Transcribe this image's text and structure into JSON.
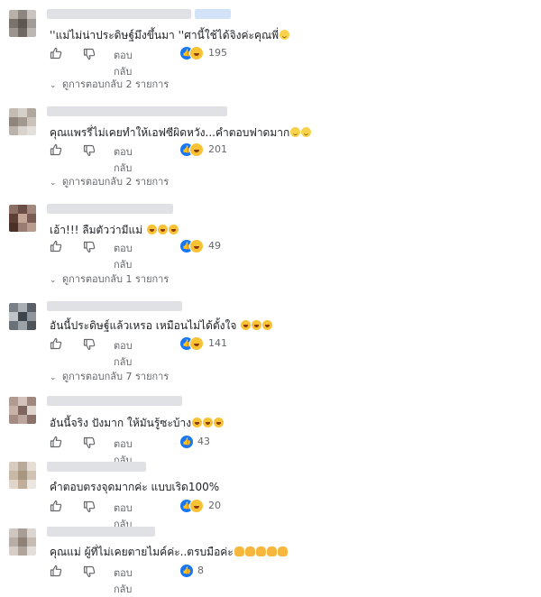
{
  "comments": [
    {
      "text": "''แม่ไม่น่าประดิษฐ์มึงขึ้นมา ''ศานี้ใช้ได้จิงค่ะคุณพี่",
      "emojis": [
        "smile"
      ],
      "reaction_count": "195",
      "reactions": [
        "like",
        "haha"
      ],
      "reply_label": "ตอบกลับ",
      "view_replies": "ดูการตอบกลับ 2 รายการ"
    },
    {
      "text": "คุณแพรรี่ไม่เคยทำให้เอฟซีผิดหวัง...คำตอบฟาดมาก",
      "emojis": [
        "smile",
        "smile"
      ],
      "reaction_count": "201",
      "reactions": [
        "like",
        "haha"
      ],
      "reply_label": "ตอบกลับ",
      "view_replies": "ดูการตอบกลับ 2 รายการ"
    },
    {
      "text": "เอ้า!!! ลืมตัวว่ามีแม่ ",
      "emojis": [
        "laugh",
        "laugh",
        "laugh"
      ],
      "reaction_count": "49",
      "reactions": [
        "like",
        "haha"
      ],
      "reply_label": "ตอบกลับ",
      "view_replies": "ดูการตอบกลับ 1 รายการ"
    },
    {
      "text": "อันนี้ประดิษฐ์แล้วเหรอ เหมือนไม่ได้ตั้งใจ ",
      "emojis": [
        "laugh",
        "laugh",
        "laugh"
      ],
      "reaction_count": "141",
      "reactions": [
        "like",
        "haha"
      ],
      "reply_label": "ตอบกลับ",
      "view_replies": "ดูการตอบกลับ 7 รายการ"
    },
    {
      "text": "อันนี้จริง ปังมาก ให้มันรู้ซะบ้าง",
      "emojis": [
        "laugh",
        "laugh",
        "laugh"
      ],
      "reaction_count": "43",
      "reactions": [
        "like"
      ],
      "reply_label": "ตอบกลับ",
      "view_replies": ""
    },
    {
      "text": "คำตอบตรงจุดมากค่ะ แบบเริด100%",
      "emojis": [],
      "reaction_count": "20",
      "reactions": [
        "like",
        "haha"
      ],
      "reply_label": "ตอบกลับ",
      "view_replies": ""
    },
    {
      "text": "คุณแม่ ผู้ที่ไม่เคยตายไมค์ค่ะ..ตรบมือค่ะ",
      "emojis": [
        "hand",
        "hand",
        "hand",
        "hand",
        "hand"
      ],
      "reaction_count": "8",
      "reactions": [
        "like"
      ],
      "reply_label": "ตอบกลับ",
      "view_replies": ""
    }
  ],
  "colors": {
    "like_blue": "#1877f2",
    "secondary_text": "#65676b",
    "haha_yellow": "#f7c234"
  }
}
